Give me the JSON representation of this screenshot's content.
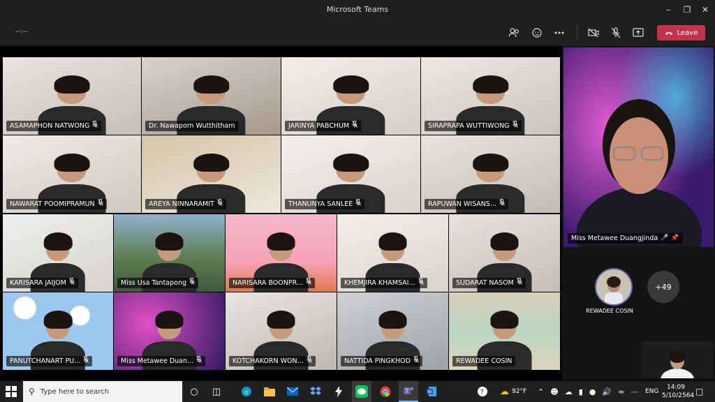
{
  "window": {
    "title": "Microsoft Teams"
  },
  "toolbar": {
    "timer": "--:--",
    "leave_label": "Leave"
  },
  "grid_tiles": [
    {
      "name": "ASAMAPHON NATWONG",
      "muted": true
    },
    {
      "name": "Dr. Nawaporn Wutthitham",
      "muted": false
    },
    {
      "name": "JARINYA PABCHUM",
      "muted": true
    },
    {
      "name": "SIRAPRAPA WUTTIWONG",
      "muted": true
    },
    {
      "name": "NAWARAT POOMIPRAMUN",
      "muted": true
    },
    {
      "name": "AREYA NINNARAMIT",
      "muted": true
    },
    {
      "name": "THANUNYA SANLEE",
      "muted": true
    },
    {
      "name": "RAPUWAN WISANS...",
      "muted": true
    },
    {
      "name": "KARISARA JAIJOM",
      "muted": true
    },
    {
      "name": "Miss Usa Tantapong",
      "muted": true
    },
    {
      "name": "NARISARA BOONPR...",
      "muted": true
    },
    {
      "name": "KHEMJIRA KHAMSAI...",
      "muted": true
    },
    {
      "name": "SUDARAT NASOM",
      "muted": true
    },
    {
      "name": "PANUTCHANART PU...",
      "muted": true
    },
    {
      "name": "Miss Metawee Duan...",
      "muted": true
    },
    {
      "name": "KOTCHAKORN WON...",
      "muted": true
    },
    {
      "name": "NATTIDA PINGKHOD",
      "muted": true
    },
    {
      "name": "REWADEE COSIN",
      "muted": false
    }
  ],
  "speaker": {
    "name": "Miss Metawee Duangjinda"
  },
  "participant_avatar": {
    "name": "REWADEE COSIN"
  },
  "overflow_count": "+49",
  "taskbar": {
    "search_placeholder": "Type here to search",
    "weather": "92°F",
    "language": "ENG",
    "time": "14:09",
    "date": "5/10/2564"
  },
  "colors": {
    "leave": "#c4314b",
    "accent": "#6264a7",
    "taskbar": "#202020"
  }
}
